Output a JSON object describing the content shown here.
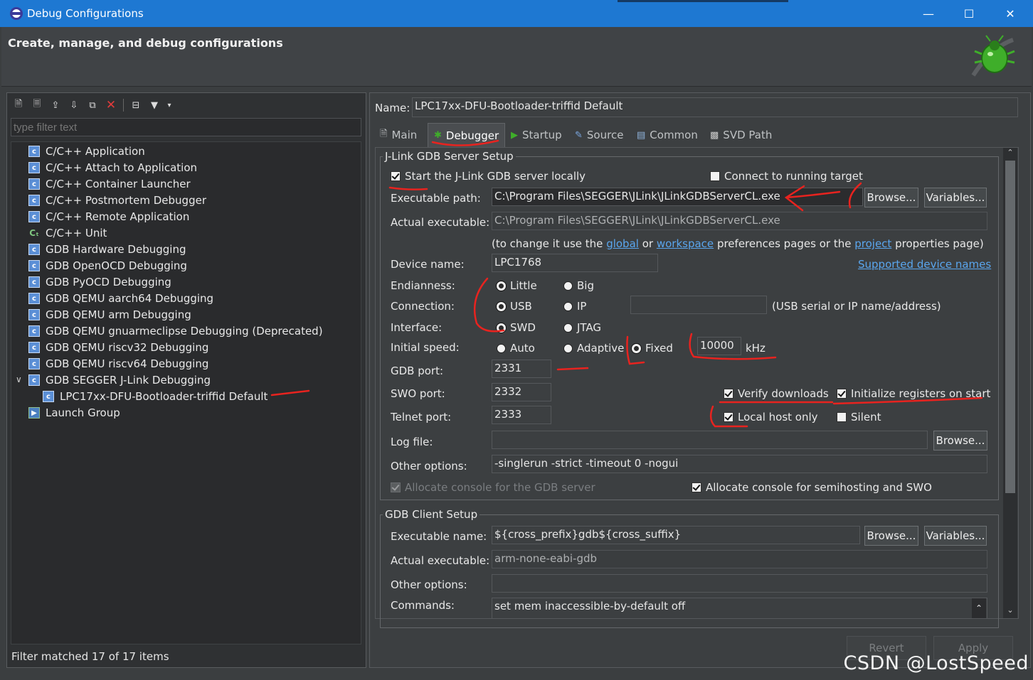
{
  "window": {
    "title": "Debug Configurations",
    "heading": "Create, manage, and debug configurations"
  },
  "left": {
    "filter_placeholder": "type filter text",
    "tree": [
      "C/C++ Application",
      "C/C++ Attach to Application",
      "C/C++ Container Launcher",
      "C/C++ Postmortem Debugger",
      "C/C++ Remote Application",
      "C/C++ Unit",
      "GDB Hardware Debugging",
      "GDB OpenOCD Debugging",
      "GDB PyOCD Debugging",
      "GDB QEMU aarch64 Debugging",
      "GDB QEMU arm Debugging",
      "GDB QEMU gnuarmeclipse Debugging (Deprecated)",
      "GDB QEMU riscv32 Debugging",
      "GDB QEMU riscv64 Debugging",
      "GDB SEGGER J-Link Debugging",
      "LPC17xx-DFU-Bootloader-triffid Default",
      "Launch Group"
    ],
    "status": "Filter matched 17 of 17 items"
  },
  "right": {
    "name_label": "Name:",
    "name_value": "LPC17xx-DFU-Bootloader-triffid Default",
    "tabs": [
      "Main",
      "Debugger",
      "Startup",
      "Source",
      "Common",
      "SVD Path"
    ],
    "server": {
      "group": "J-Link GDB Server Setup",
      "start_locally": "Start the J-Link GDB server locally",
      "connect_running": "Connect to running target",
      "exec_path_label": "Executable path:",
      "exec_path": "C:\\Program Files\\SEGGER\\JLink\\JLinkGDBServerCL.exe",
      "browse": "Browse...",
      "variables": "Variables...",
      "actual_label": "Actual executable:",
      "actual": "C:\\Program Files\\SEGGER\\JLink\\JLinkGDBServerCL.exe",
      "hint_prefix": "(to change it use the",
      "hint_global": "global",
      "hint_or": "or",
      "hint_workspace": "workspace",
      "hint_middle": "preferences pages or the",
      "hint_project": "project",
      "hint_suffix": "properties page)",
      "device_label": "Device name:",
      "device": "LPC1768",
      "supported_link": "Supported device names",
      "endianness_label": "Endianness:",
      "little": "Little",
      "big": "Big",
      "connection_label": "Connection:",
      "usb": "USB",
      "ip": "IP",
      "usb_hint": "(USB serial or IP name/address)",
      "interface_label": "Interface:",
      "swd": "SWD",
      "jtag": "JTAG",
      "speed_label": "Initial speed:",
      "auto": "Auto",
      "adaptive": "Adaptive",
      "fixed": "Fixed",
      "speed": "10000",
      "khz": "kHz",
      "gdb_port_label": "GDB port:",
      "gdb_port": "2331",
      "swo_port_label": "SWO port:",
      "swo_port": "2332",
      "telnet_port_label": "Telnet port:",
      "telnet_port": "2333",
      "verify": "Verify downloads",
      "init_regs": "Initialize registers on start",
      "local_host": "Local host only",
      "silent": "Silent",
      "log_label": "Log file:",
      "other_label": "Other options:",
      "other": "-singlerun -strict -timeout 0 -nogui",
      "alloc_gdb": "Allocate console for the GDB server",
      "alloc_semi": "Allocate console for semihosting and SWO"
    },
    "client": {
      "group": "GDB Client Setup",
      "exec_name_label": "Executable name:",
      "exec_name": "${cross_prefix}gdb${cross_suffix}",
      "actual_label": "Actual executable:",
      "actual": "arm-none-eabi-gdb",
      "other_label": "Other options:",
      "commands_label": "Commands:",
      "commands": "set mem inaccessible-by-default off"
    },
    "revert": "Revert",
    "apply": "Apply"
  },
  "watermark": "CSDN @LostSpeed",
  "colors": {
    "titlebar": "#1e78d2",
    "annotation": "#e8231f",
    "link": "#5aa6ee"
  }
}
